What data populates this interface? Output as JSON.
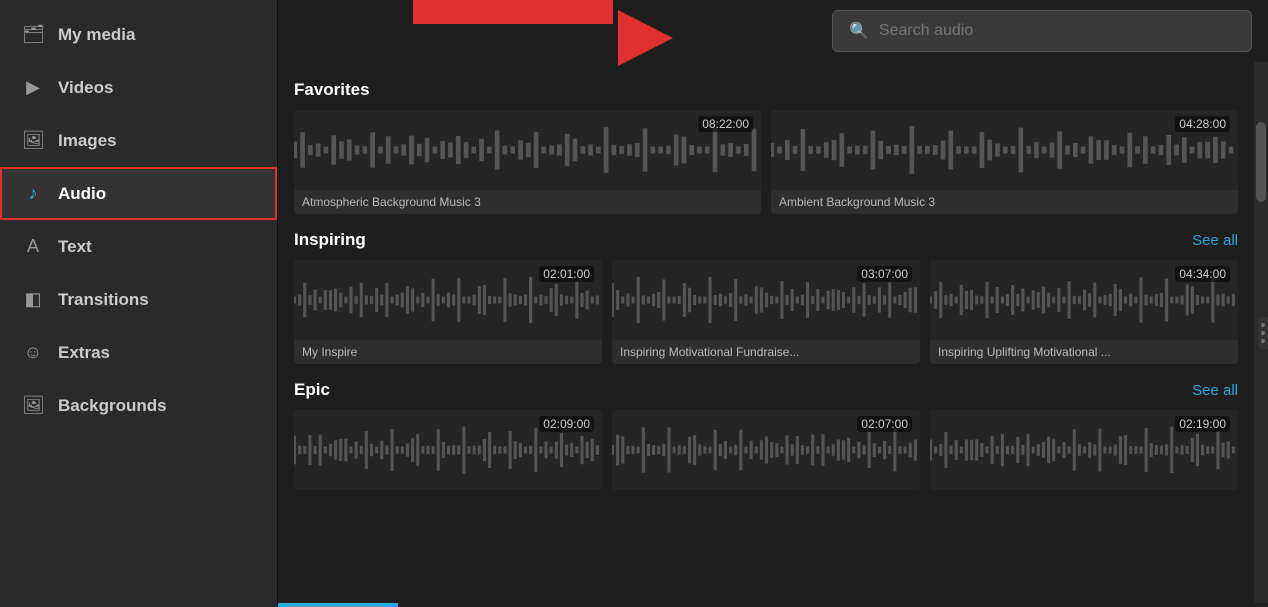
{
  "sidebar": {
    "items": [
      {
        "id": "my-media",
        "label": "My media",
        "icon": "🗂",
        "active": false
      },
      {
        "id": "videos",
        "label": "Videos",
        "icon": "▶",
        "active": false
      },
      {
        "id": "images",
        "label": "Images",
        "icon": "🖼",
        "active": false
      },
      {
        "id": "audio",
        "label": "Audio",
        "icon": "♪",
        "active": true
      },
      {
        "id": "text",
        "label": "Text",
        "icon": "A",
        "active": false
      },
      {
        "id": "transitions",
        "label": "Transitions",
        "icon": "◧",
        "active": false
      },
      {
        "id": "extras",
        "label": "Extras",
        "icon": "☺",
        "active": false
      },
      {
        "id": "backgrounds",
        "label": "Backgrounds",
        "icon": "🖼",
        "active": false
      }
    ]
  },
  "header": {
    "search_placeholder": "Search audio"
  },
  "sections": [
    {
      "id": "favorites",
      "title": "Favorites",
      "show_see_all": false,
      "see_all_label": "",
      "tracks": [
        {
          "name": "Atmospheric Background Music 3",
          "duration": "08:22:00"
        },
        {
          "name": "Ambient Background Music 3",
          "duration": "04:28:00"
        }
      ]
    },
    {
      "id": "inspiring",
      "title": "Inspiring",
      "show_see_all": true,
      "see_all_label": "See all",
      "tracks": [
        {
          "name": "My Inspire",
          "duration": "02:01:00"
        },
        {
          "name": "Inspiring Motivational Fundraise...",
          "duration": "03:07:00"
        },
        {
          "name": "Inspiring Uplifting Motivational ...",
          "duration": "04:34:00"
        }
      ]
    },
    {
      "id": "epic",
      "title": "Epic",
      "show_see_all": true,
      "see_all_label": "See all",
      "tracks": [
        {
          "name": "",
          "duration": "02:09:00"
        },
        {
          "name": "",
          "duration": "02:07:00"
        },
        {
          "name": "",
          "duration": "02:19:00"
        }
      ]
    }
  ]
}
